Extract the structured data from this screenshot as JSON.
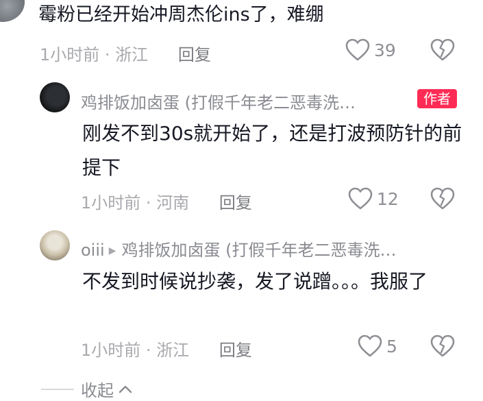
{
  "top_comment": {
    "text": "霉粉已经开始冲周杰伦ins了，难绷",
    "time": "1小时前",
    "location": "浙江",
    "reply_label": "回复",
    "likes": "39"
  },
  "replies": [
    {
      "nickname": "鸡排饭加卤蛋 (打假千年老二恶毒洗…",
      "badge": "作者",
      "text": "刚发不到30s就开始了，还是打波预防针的前提下",
      "time": "1小时前",
      "location": "河南",
      "reply_label": "回复",
      "likes": "12"
    },
    {
      "nickname": "oiii",
      "reply_to": "鸡排饭加卤蛋 (打假千年老二恶毒洗…",
      "text": "不发到时候说抄袭，发了说蹭。。。我服了",
      "time": "1小时前",
      "location": "浙江",
      "reply_label": "回复",
      "likes": "5"
    }
  ],
  "collapse_label": "收起",
  "colors": {
    "text": "#161823",
    "meta": "#a8a9ad",
    "badge": "#fe2c55"
  }
}
